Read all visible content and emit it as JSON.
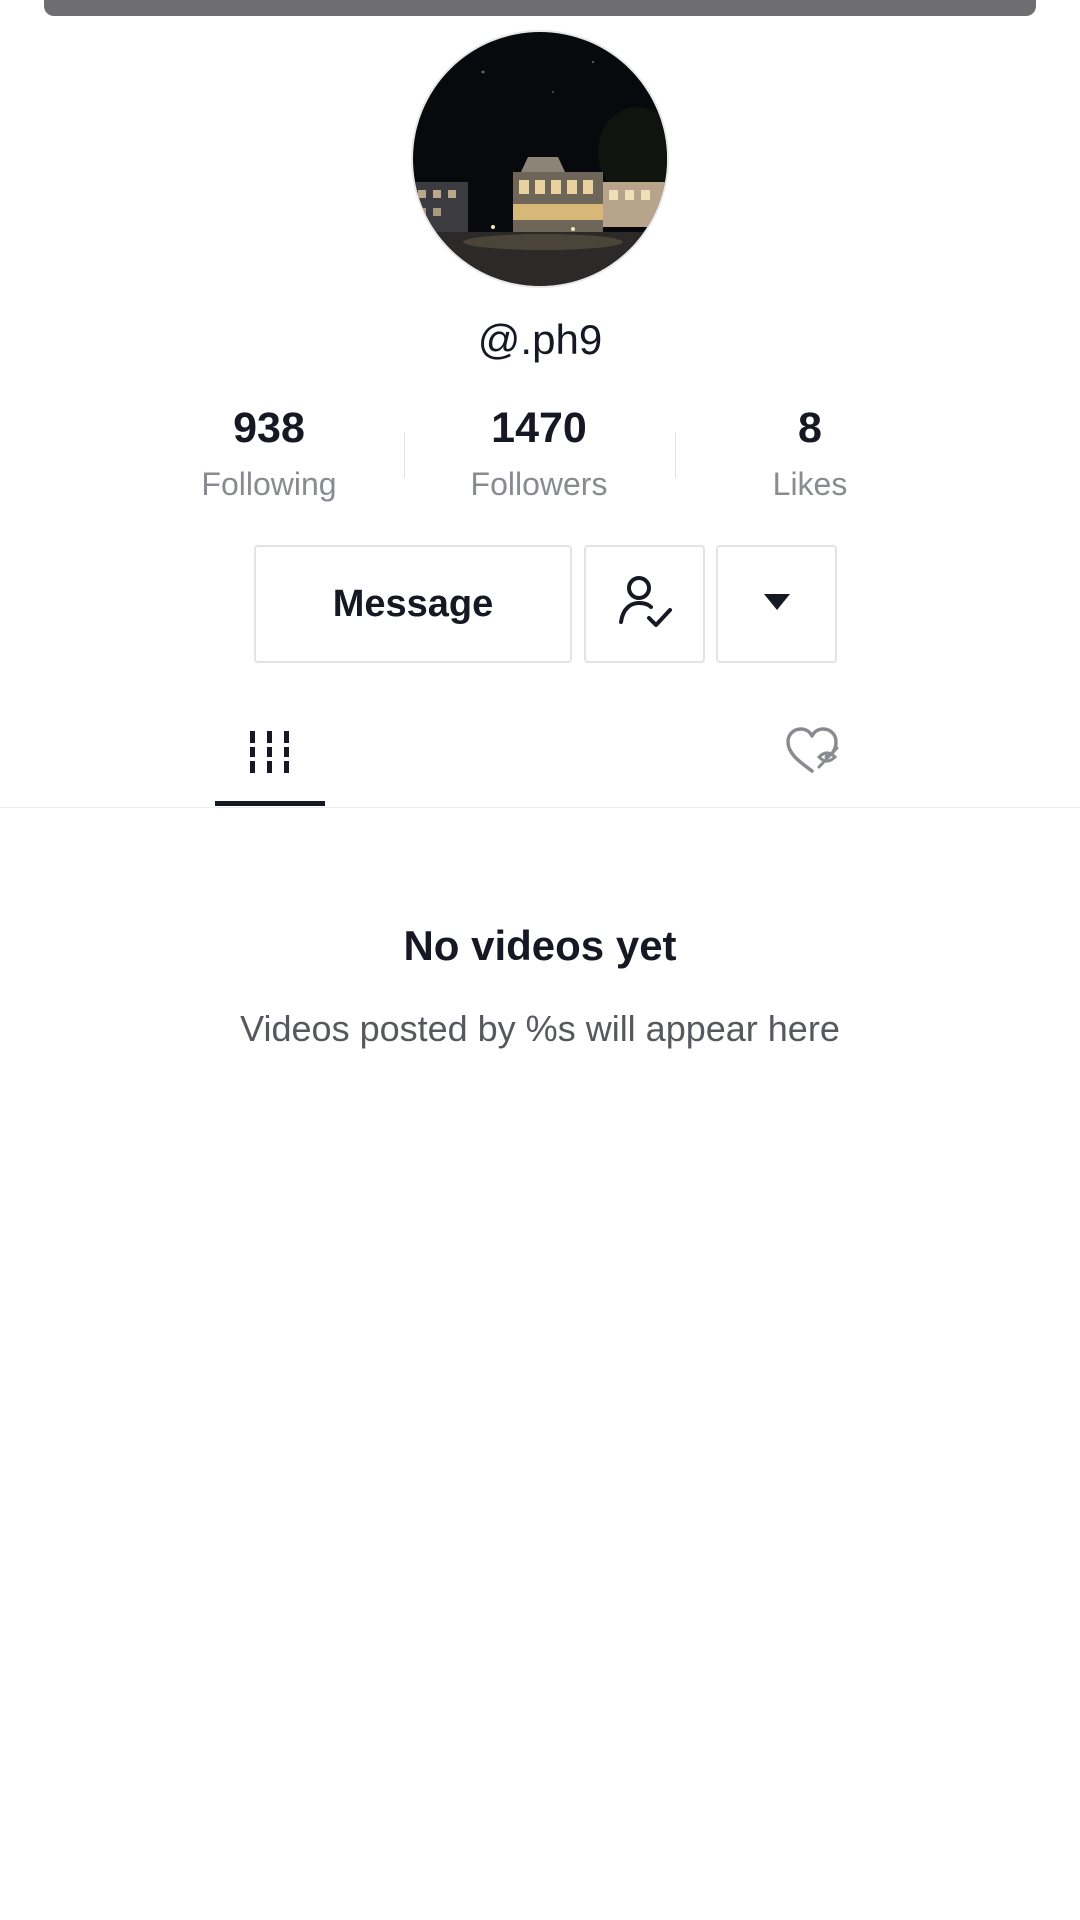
{
  "profile": {
    "username": "@.ph9"
  },
  "stats": {
    "following": {
      "value": "938",
      "label": "Following"
    },
    "followers": {
      "value": "1470",
      "label": "Followers"
    },
    "likes": {
      "value": "8",
      "label": "Likes"
    }
  },
  "actions": {
    "message_label": "Message",
    "follow_icon": "user-check-icon",
    "more_icon": "caret-down-icon"
  },
  "tabs": [
    {
      "icon": "grid-icon",
      "selected": true
    },
    {
      "icon": "heart-hidden-icon",
      "selected": false
    }
  ],
  "empty_state": {
    "title": "No videos yet",
    "subtitle": "Videos posted by %s will appear here"
  }
}
